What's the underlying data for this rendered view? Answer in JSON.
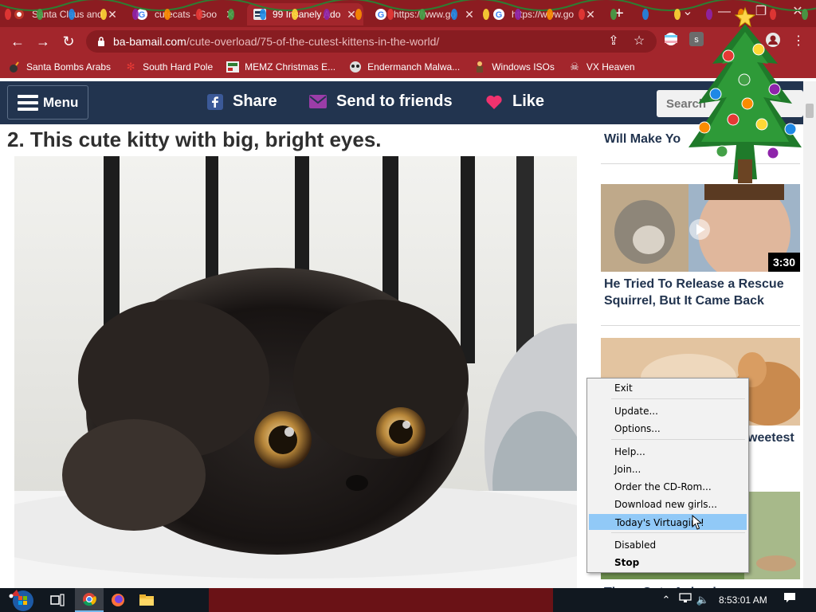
{
  "browser": {
    "tabs": [
      {
        "title": "Santa Claus and"
      },
      {
        "title": "cutecats - Goo"
      },
      {
        "title": "99 Insanely Ado"
      },
      {
        "title": "https://www.go"
      },
      {
        "title": "https://www.go"
      }
    ],
    "url_host": "ba-bamail.com",
    "url_path": "/cute-overload/75-of-the-cutest-kittens-in-the-world/",
    "bookmarks": [
      {
        "label": "Santa Bombs Arabs"
      },
      {
        "label": "South Hard Pole"
      },
      {
        "label": "MEMZ Christmas E..."
      },
      {
        "label": "Endermanch Malwa..."
      },
      {
        "label": "Windows ISOs"
      },
      {
        "label": "VX Heaven"
      }
    ]
  },
  "site": {
    "menu_label": "Menu",
    "share_label": "Share",
    "send_label": "Send to friends",
    "like_label": "Like",
    "search_placeholder": "Search"
  },
  "article": {
    "heading": "2. This cute kitty with big, bright eyes."
  },
  "sidebar": {
    "partial_title": "Will Make Yo",
    "video_duration": "3:30",
    "video_title_line1": "He Tried To Release a Rescue",
    "video_title_line2": "Squirrel, But It Came Back",
    "partial_title2": "weetest",
    "partial_title3": "Three Cute Animals..."
  },
  "context_menu": {
    "items": [
      {
        "label": "Exit"
      },
      {
        "label": "Update..."
      },
      {
        "label": "Options..."
      },
      {
        "label": "Help..."
      },
      {
        "label": "Join..."
      },
      {
        "label": "Order the CD-Rom..."
      },
      {
        "label": "Download new girls..."
      },
      {
        "label": "Today's Virtuagirl !"
      },
      {
        "label": "Disabled"
      },
      {
        "label": "Stop"
      }
    ],
    "highlighted_index": 7
  },
  "taskbar": {
    "clock": "8:53:01 AM"
  },
  "colors": {
    "chrome_frame": "#8c1c21",
    "site_header": "#22344f",
    "like_heart": "#f0326e",
    "send_envelope": "#9b3da8",
    "facebook": "#3b5998",
    "menu_highlight": "#91c9f7"
  }
}
